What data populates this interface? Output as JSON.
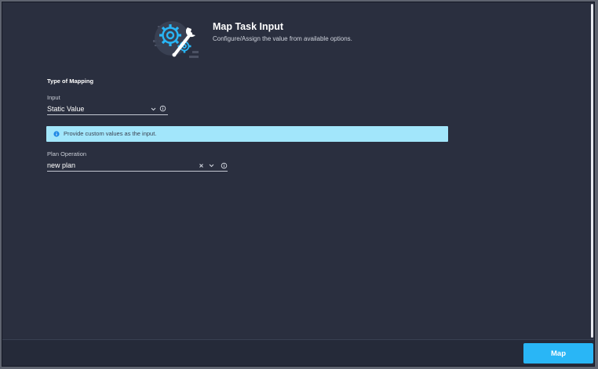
{
  "header": {
    "title": "Map Task Input",
    "subtitle": "Configure/Assign the value from available options.",
    "icon": "gear-wrench-icon"
  },
  "mapping": {
    "section_title": "Type of Mapping",
    "input": {
      "label": "Input",
      "value": "Static Value",
      "icons": [
        "chevron-down-icon",
        "info-icon"
      ]
    }
  },
  "info_banner": {
    "text": "Provide custom values as the input.",
    "icon": "info-filled-icon"
  },
  "plan_operation": {
    "label": "Plan Operation",
    "value": "new plan",
    "icons": [
      "clear-icon",
      "chevron-down-icon",
      "info-icon"
    ]
  },
  "footer": {
    "map_button": "Map"
  },
  "colors": {
    "background": "#2a2f3f",
    "accent": "#29b6f6",
    "banner": "#a2e6fb",
    "text": "#ffffff",
    "muted_text": "#c9cdd6"
  }
}
